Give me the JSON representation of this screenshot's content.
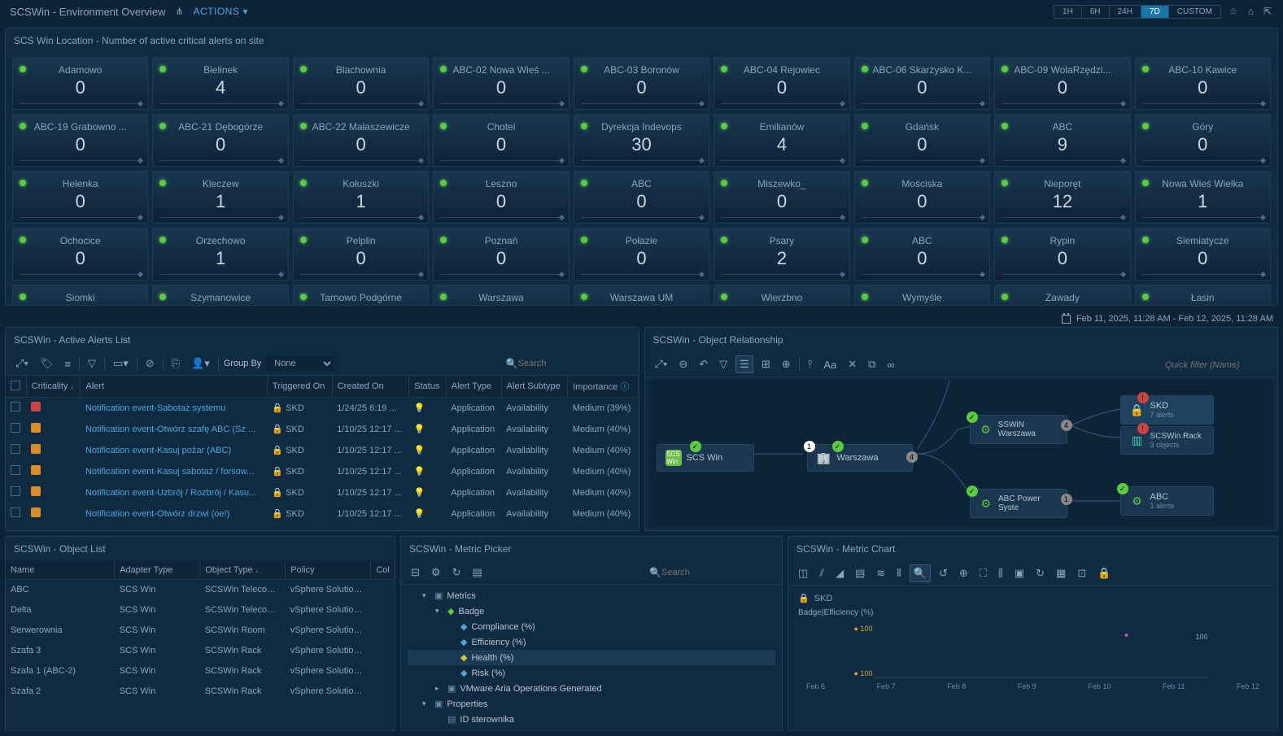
{
  "topbar": {
    "title": "SCSWin - Environment Overview",
    "actions": "ACTIONS",
    "timeRanges": [
      "1H",
      "6H",
      "24H",
      "7D",
      "CUSTOM"
    ],
    "activeRange": "7D"
  },
  "heatmap": {
    "title": "SCS Win Location - Number of active critical alerts on site",
    "tiles": [
      {
        "name": "Adamowo",
        "value": 0
      },
      {
        "name": "Bielinek",
        "value": 4
      },
      {
        "name": "Blachownia",
        "value": 0
      },
      {
        "name": "ABC-02 Nowa Wieś ...",
        "value": 0
      },
      {
        "name": "ABC-03 Boronów",
        "value": 0
      },
      {
        "name": "ABC-04 Rejowiec",
        "value": 0
      },
      {
        "name": "ABC-06 Skarżysko K...",
        "value": 0
      },
      {
        "name": "ABC-09 WolaRzędzi...",
        "value": 0
      },
      {
        "name": "ABC-10 Kawice",
        "value": 0
      },
      {
        "name": "ABC-19 Grabowno ...",
        "value": 0
      },
      {
        "name": "ABC-21 Dębogórze",
        "value": 0
      },
      {
        "name": "ABC-22 Małaszewicze",
        "value": 0
      },
      {
        "name": "Chotel",
        "value": 0
      },
      {
        "name": "Dyrekcja Indevops",
        "value": 30
      },
      {
        "name": "Emilianów",
        "value": 4
      },
      {
        "name": "Gdańsk",
        "value": 0
      },
      {
        "name": "ABC",
        "value": 9
      },
      {
        "name": "Góry",
        "value": 0
      },
      {
        "name": "Helenka",
        "value": 0
      },
      {
        "name": "Kleczew",
        "value": 1
      },
      {
        "name": "Kołuszki",
        "value": 1
      },
      {
        "name": "Leszno",
        "value": 0
      },
      {
        "name": "ABC",
        "value": 0
      },
      {
        "name": "Miszewko_",
        "value": 0
      },
      {
        "name": "Mościska",
        "value": 0
      },
      {
        "name": "Nieporęt",
        "value": 12
      },
      {
        "name": "Nowa Wieś Wielka",
        "value": 1
      },
      {
        "name": "Ochocice",
        "value": 0
      },
      {
        "name": "Orzechowo",
        "value": 1
      },
      {
        "name": "Pelplin",
        "value": 0
      },
      {
        "name": "Poznań",
        "value": 0
      },
      {
        "name": "Połazie",
        "value": 0
      },
      {
        "name": "Psary",
        "value": 2
      },
      {
        "name": "ABC",
        "value": 0
      },
      {
        "name": "Rypin",
        "value": 0
      },
      {
        "name": "Siemiatycze",
        "value": 0
      },
      {
        "name": "Siomki",
        "value": ""
      },
      {
        "name": "Szymanowice",
        "value": ""
      },
      {
        "name": "Tarnowo Podgórne",
        "value": ""
      },
      {
        "name": "Warszawa",
        "value": ""
      },
      {
        "name": "Warszawa UM",
        "value": ""
      },
      {
        "name": "Wierzbno",
        "value": ""
      },
      {
        "name": "Wymyśle",
        "value": ""
      },
      {
        "name": "Zawady",
        "value": ""
      },
      {
        "name": "Łasin",
        "value": ""
      }
    ]
  },
  "timestamp": "Feb 11, 2025, 11:28 AM - Feb 12, 2025, 11:28 AM",
  "alerts": {
    "title": "SCSWin - Active Alerts List",
    "groupBy": "Group By",
    "groupByValue": "None",
    "searchPlaceholder": "Search",
    "columns": [
      "",
      "Criticality",
      "Alert",
      "Triggered On",
      "Created On",
      "Status",
      "Alert Type",
      "Alert Subtype",
      "Importance"
    ],
    "rows": [
      {
        "crit": "red",
        "alert": "Notification event-Sabotaż systemu",
        "trigOn": "SKD",
        "created": "1/24/25 6:19 ...",
        "type": "Application",
        "sub": "Availability",
        "imp": "Medium (39%)"
      },
      {
        "crit": "orange",
        "alert": "Notification event-Otwórz szafę ABC (Sz ...",
        "trigOn": "SKD",
        "created": "1/10/25 12:17 ...",
        "type": "Application",
        "sub": "Availability",
        "imp": "Medium (40%)"
      },
      {
        "crit": "orange",
        "alert": "Notification event-Kasuj pożar (ABC)",
        "trigOn": "SKD",
        "created": "1/10/25 12:17 ...",
        "type": "Application",
        "sub": "Availability",
        "imp": "Medium (40%)"
      },
      {
        "crit": "orange",
        "alert": "Notification event-Kasuj sabotaż / forsow...",
        "trigOn": "SKD",
        "created": "1/10/25 12:17 ...",
        "type": "Application",
        "sub": "Availability",
        "imp": "Medium (40%)"
      },
      {
        "crit": "orange",
        "alert": "Notification event-Uzbrój / Rozbrój / Kasu...",
        "trigOn": "SKD",
        "created": "1/10/25 12:17 ...",
        "type": "Application",
        "sub": "Availability",
        "imp": "Medium (40%)"
      },
      {
        "crit": "orange",
        "alert": "Notification event-Otwórz drzwi (oe!)",
        "trigOn": "SKD",
        "created": "1/10/25 12:17 ...",
        "type": "Application",
        "sub": "Availability",
        "imp": "Medium (40%)"
      }
    ]
  },
  "relationship": {
    "title": "SCSWin - Object Relationship",
    "quickFilterPlaceholder": "Quick filter (Name)",
    "nodes": {
      "root": "SCS Win",
      "mid": "Warszawa",
      "sswin": "SSWiN Warszawa",
      "power": "ABC Power Syste",
      "skd": "SKD",
      "skdSub": "7 alerts",
      "rack": "SCSWin Rack",
      "rackSub": "3 objects",
      "abc": "ABC",
      "abcSub": "1 alerts"
    }
  },
  "objList": {
    "title": "SCSWin - Object List",
    "columns": [
      "Name",
      "Adapter Type",
      "Object Type",
      "Policy",
      "Col"
    ],
    "rows": [
      {
        "name": "ABC",
        "adapter": "SCS Win",
        "obj": "SCSWin Telecom Po...",
        "policy": "vSphere Solution's D..."
      },
      {
        "name": "Delta",
        "adapter": "SCS Win",
        "obj": "SCSWin Telecom Po...",
        "policy": "vSphere Solution's D..."
      },
      {
        "name": "Serwerownia",
        "adapter": "SCS Win",
        "obj": "SCSWin Room",
        "policy": "vSphere Solution's D..."
      },
      {
        "name": "Szafa 3",
        "adapter": "SCS Win",
        "obj": "SCSWin Rack",
        "policy": "vSphere Solution's D..."
      },
      {
        "name": "Szafa 1 (ABC-2)",
        "adapter": "SCS Win",
        "obj": "SCSWin Rack",
        "policy": "vSphere Solution's D..."
      },
      {
        "name": "Szafa 2",
        "adapter": "SCS Win",
        "obj": "SCSWin Rack",
        "policy": "vSphere Solution's D..."
      }
    ]
  },
  "metricPicker": {
    "title": "SCSWin - Metric Picker",
    "searchPlaceholder": "Search",
    "tree": {
      "metrics": "Metrics",
      "badge": "Badge",
      "compliance": "Compliance (%)",
      "efficiency": "Efficiency (%)",
      "health": "Health (%)",
      "risk": "Risk (%)",
      "vmware": "VMware Aria Operations Generated",
      "properties": "Properties",
      "idster": "ID sterownika"
    }
  },
  "metricChart": {
    "title": "SCSWin - Metric Chart",
    "legend": "SKD",
    "metricName": "Badge|Efficiency (%)"
  },
  "chart_data": {
    "type": "line",
    "title": "Badge|Efficiency (%)",
    "x": [
      "Feb 6",
      "Feb 7",
      "Feb 8",
      "Feb 9",
      "Feb 10",
      "Feb 11",
      "Feb 12"
    ],
    "series": [
      {
        "name": "SKD",
        "values": [
          100,
          100,
          100,
          100,
          100,
          100,
          100
        ]
      }
    ],
    "ylim": [
      0,
      100
    ],
    "yTicks": [
      100
    ],
    "yRightLabel": 100
  }
}
